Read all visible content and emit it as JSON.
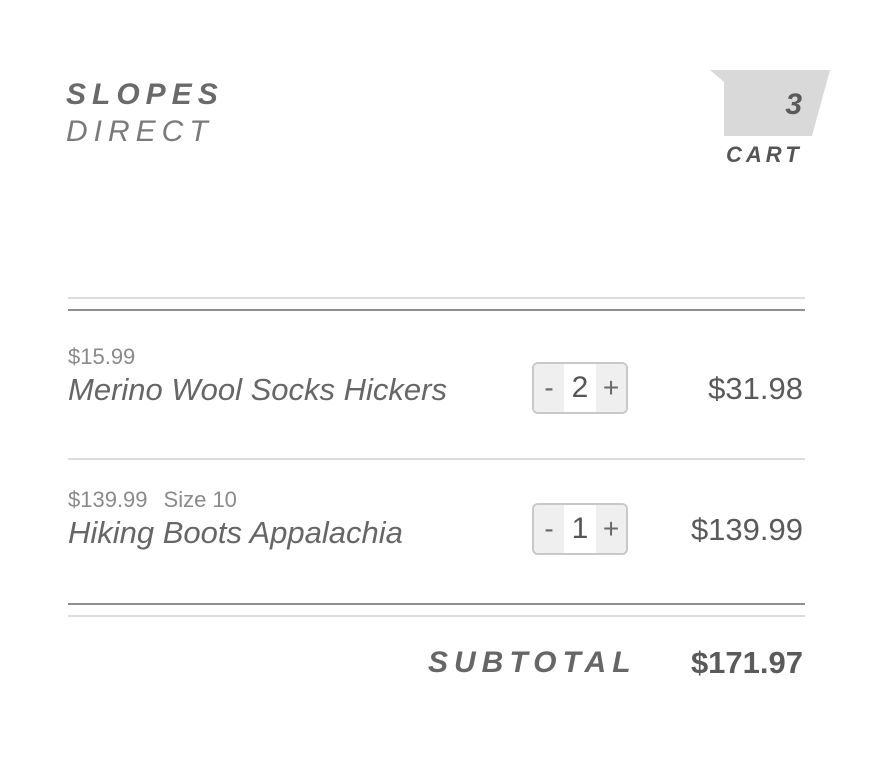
{
  "brand": {
    "line1": "SLOPES",
    "line2": "DIRECT"
  },
  "cart": {
    "count": "3",
    "label": "CART",
    "badge_color": "#d9d9d9"
  },
  "items": [
    {
      "unit_price": "$15.99",
      "size": "",
      "name": "Merino Wool Socks Hickers",
      "decrement": "-",
      "quantity": "2",
      "increment": "+",
      "total": "$31.98"
    },
    {
      "unit_price": "$139.99",
      "size": "Size 10",
      "name": "Hiking Boots Appalachia",
      "decrement": "-",
      "quantity": "1",
      "increment": "+",
      "total": "$139.99"
    }
  ],
  "summary": {
    "subtotal_label": "SUBTOTAL",
    "subtotal_value": "$171.97"
  }
}
